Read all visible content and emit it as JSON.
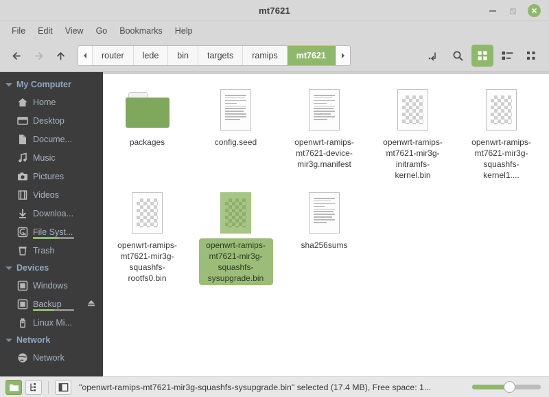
{
  "window": {
    "title": "mt7621",
    "minimize_label": "Minimize",
    "maximize_label": "Restore",
    "close_label": "Close"
  },
  "menubar": {
    "items": [
      {
        "label": "File"
      },
      {
        "label": "Edit"
      },
      {
        "label": "View"
      },
      {
        "label": "Go"
      },
      {
        "label": "Bookmarks"
      },
      {
        "label": "Help"
      }
    ]
  },
  "toolbar": {
    "back_label": "Back",
    "forward_label": "Forward",
    "up_label": "Up",
    "path_prev_label": "Scroll path left",
    "path_next_label": "Scroll path right",
    "breadcrumbs": [
      {
        "label": "router",
        "active": false
      },
      {
        "label": "lede",
        "active": false
      },
      {
        "label": "bin",
        "active": false
      },
      {
        "label": "targets",
        "active": false
      },
      {
        "label": "ramips",
        "active": false
      },
      {
        "label": "mt7621",
        "active": true
      }
    ],
    "path_entry_label": "Toggle path entry",
    "search_label": "Search",
    "icon_view_label": "Icon view",
    "list_view_label": "List view",
    "compact_view_label": "Compact view"
  },
  "sidebar": {
    "groups": [
      {
        "title": "My Computer",
        "name": "my-computer",
        "items": [
          {
            "label": "Home",
            "icon": "home-icon",
            "usage": null,
            "eject": false
          },
          {
            "label": "Desktop",
            "icon": "desktop-icon",
            "usage": null,
            "eject": false
          },
          {
            "label": "Docume...",
            "icon": "documents-icon",
            "usage": null,
            "eject": false
          },
          {
            "label": "Music",
            "icon": "music-icon",
            "usage": null,
            "eject": false
          },
          {
            "label": "Pictures",
            "icon": "pictures-icon",
            "usage": null,
            "eject": false
          },
          {
            "label": "Videos",
            "icon": "videos-icon",
            "usage": null,
            "eject": false
          },
          {
            "label": "Downloa...",
            "icon": "downloads-icon",
            "usage": null,
            "eject": false
          },
          {
            "label": "File Syst...",
            "icon": "filesystem-icon",
            "usage": 62,
            "eject": false
          },
          {
            "label": "Trash",
            "icon": "trash-icon",
            "usage": null,
            "eject": false
          }
        ]
      },
      {
        "title": "Devices",
        "name": "devices",
        "items": [
          {
            "label": "Windows",
            "icon": "drive-icon",
            "usage": null,
            "eject": false
          },
          {
            "label": "Backup",
            "icon": "drive-icon",
            "usage": 52,
            "eject": true
          },
          {
            "label": "Linux Mi...",
            "icon": "usb-drive-icon",
            "usage": null,
            "eject": false
          }
        ]
      },
      {
        "title": "Network",
        "name": "network",
        "items": [
          {
            "label": "Network",
            "icon": "globe-icon",
            "usage": null,
            "eject": false
          }
        ]
      }
    ]
  },
  "files": [
    {
      "name": "packages",
      "type": "folder",
      "selected": false
    },
    {
      "name": "config.seed",
      "type": "document",
      "selected": false
    },
    {
      "name": "openwrt-ramips-mt7621-device-mir3g.manifest",
      "type": "document",
      "selected": false
    },
    {
      "name": "openwrt-ramips-mt7621-mir3g-initramfs-kernel.bin",
      "type": "binary",
      "selected": false
    },
    {
      "name": "openwrt-ramips-mt7621-mir3g-squashfs-kernel1....",
      "type": "binary",
      "selected": false
    },
    {
      "name": "openwrt-ramips-mt7621-mir3g-squashfs-rootfs0.bin",
      "type": "binary",
      "selected": false
    },
    {
      "name": "openwrt-ramips-mt7621-mir3g-squashfs-sysupgrade.bin",
      "type": "binary",
      "selected": true
    },
    {
      "name": "sha256sums",
      "type": "document",
      "selected": false
    }
  ],
  "statusbar": {
    "places_button_label": "Places",
    "tree_button_label": "Tree",
    "sidebar_toggle_label": "Show sidebar",
    "text": "\"openwrt-ramips-mt7621-mir3g-squashfs-sysupgrade.bin\" selected (17.4 MB), Free space: 1...",
    "zoom_value": 50
  },
  "colors": {
    "accent": "#8eb96d",
    "sidebar_bg": "#3c3c3c",
    "chrome_bg": "#d8d8d8",
    "selection_label": "#9cbd79"
  }
}
